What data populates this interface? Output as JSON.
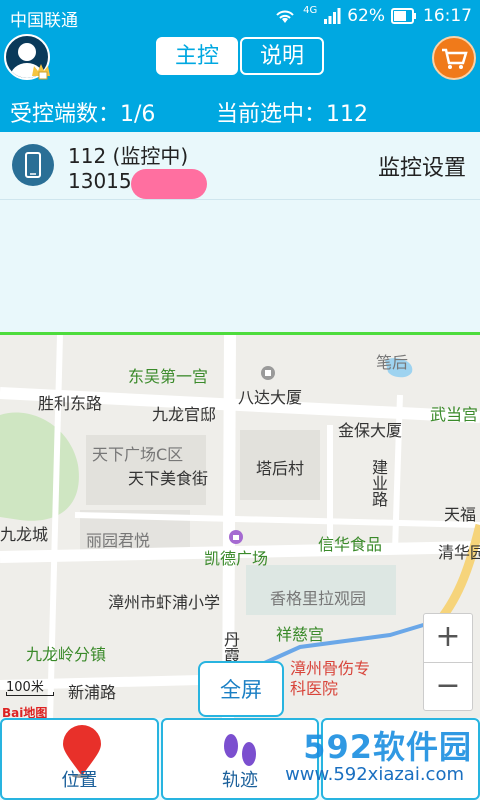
{
  "status_bar": {
    "carrier": "中国联通",
    "network": "4G",
    "battery": "62%",
    "time": "16:17"
  },
  "header": {
    "tab_control": "主控",
    "tab_help": "说明"
  },
  "summary": {
    "controlled_count": "受控端数：1/6",
    "current_selected": "当前选中：112"
  },
  "device": {
    "name": "112 (监控中)",
    "number": "13015",
    "settings": "监控设置"
  },
  "map": {
    "labels": {
      "dongwu": "东吴第一宫",
      "shengli": "胜利东路",
      "jiulong_guan": "九龙官邸",
      "bada": "八达大厦",
      "tianxia_c": "天下广场C区",
      "tianxia_food": "天下美食街",
      "tahou": "塔后村",
      "jinbao": "金保大厦",
      "jianye": "建业路",
      "wudang": "武当宫",
      "jiulong_city": "九龙城",
      "liyuan": "丽园君悦",
      "kaide": "凯德广场",
      "xinhua": "信华食品",
      "qinghua": "清华园",
      "tianfu": "天福",
      "xiapu": "漳州市虾浦小学",
      "xianggelila": "香格里拉观园",
      "xiangci": "祥慈宫",
      "jiulongling": "九龙岭分镇",
      "danxia": "丹霞路",
      "hospital": "漳州骨伤专科医院",
      "xinpu": "新浦路",
      "bigang": "笔后"
    },
    "scale": "100米",
    "provider": "Bai地图",
    "zoom_in": "+",
    "zoom_out": "−",
    "fullscreen": "全屏"
  },
  "tabs": [
    {
      "label": "位置",
      "icon": "location-pin-icon"
    },
    {
      "label": "轨迹",
      "icon": "footprints-icon"
    },
    {
      "label": "",
      "icon": "third-tab-icon"
    }
  ],
  "watermark": {
    "title": "592软件园",
    "url": "www.592xiazai.com"
  },
  "colors": {
    "primary": "#00a8e1",
    "map_border": "#4ddc3c",
    "pin": "#e8302a"
  }
}
